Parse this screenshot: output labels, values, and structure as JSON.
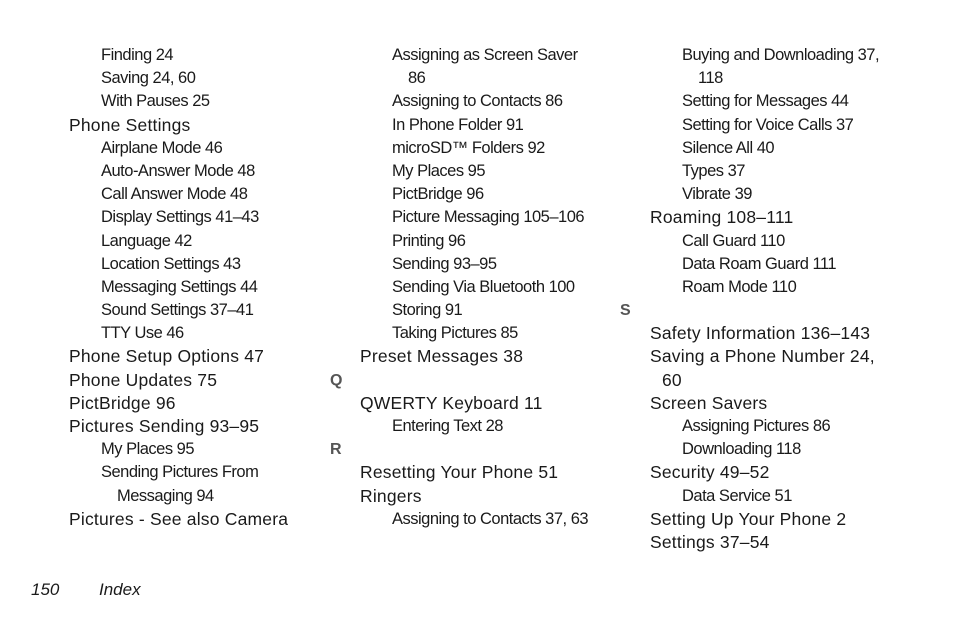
{
  "columns": [
    [
      {
        "level": "level-1",
        "text": "Finding 24"
      },
      {
        "level": "level-1",
        "text": "Saving 24, 60"
      },
      {
        "level": "level-1",
        "text": "With Pauses 25"
      },
      {
        "level": "level-0",
        "text": "Phone Settings"
      },
      {
        "level": "level-1",
        "text": "Airplane Mode 46"
      },
      {
        "level": "level-1",
        "text": "Auto-Answer Mode 48"
      },
      {
        "level": "level-1",
        "text": "Call Answer Mode 48"
      },
      {
        "level": "level-1",
        "text": "Display Settings 41–43"
      },
      {
        "level": "level-1",
        "text": "Language 42"
      },
      {
        "level": "level-1",
        "text": "Location Settings 43"
      },
      {
        "level": "level-1",
        "text": "Messaging Settings 44"
      },
      {
        "level": "level-1",
        "text": "Sound Settings 37–41"
      },
      {
        "level": "level-1",
        "text": "TTY Use 46"
      },
      {
        "level": "level-0",
        "text": "Phone Setup Options 47"
      },
      {
        "level": "level-0",
        "text": "Phone Updates 75"
      },
      {
        "level": "level-0",
        "text": "PictBridge 96"
      },
      {
        "level": "level-0",
        "text": "Pictures Sending 93–95"
      },
      {
        "level": "level-1",
        "text": "My Places 95"
      },
      {
        "level": "level-1",
        "text": "Sending Pictures From"
      },
      {
        "level": "level-1c",
        "text": "Messaging 94"
      },
      {
        "level": "level-0",
        "text": "Pictures - See also Camera"
      }
    ],
    [
      {
        "level": "level-1",
        "text": "Assigning as Screen Saver"
      },
      {
        "level": "level-1c",
        "text": "86"
      },
      {
        "level": "level-1",
        "text": "Assigning to Contacts 86"
      },
      {
        "level": "level-1",
        "text": "In Phone Folder 91"
      },
      {
        "level": "level-1",
        "text": "microSD™ Folders 92"
      },
      {
        "level": "level-1",
        "text": "My Places 95"
      },
      {
        "level": "level-1",
        "text": "PictBridge 96"
      },
      {
        "level": "level-1",
        "text": "Picture Messaging 105–106"
      },
      {
        "level": "level-1",
        "text": "Printing 96"
      },
      {
        "level": "level-1",
        "text": "Sending 93–95"
      },
      {
        "level": "level-1",
        "text": "Sending Via Bluetooth 100"
      },
      {
        "level": "level-1",
        "text": "Storing 91"
      },
      {
        "level": "level-1",
        "text": "Taking Pictures 85"
      },
      {
        "level": "level-0",
        "text": "Preset Messages 38"
      },
      {
        "level": "letter",
        "text": "Q"
      },
      {
        "level": "level-0",
        "text": "QWERTY Keyboard 11"
      },
      {
        "level": "level-1",
        "text": "Entering Text 28"
      },
      {
        "level": "letter",
        "text": "R"
      },
      {
        "level": "level-0",
        "text": "Resetting Your Phone 51"
      },
      {
        "level": "level-0",
        "text": "Ringers"
      },
      {
        "level": "level-1",
        "text": "Assigning to Contacts 37, 63"
      }
    ],
    [
      {
        "level": "level-1",
        "text": "Buying and Downloading 37,"
      },
      {
        "level": "level-1c",
        "text": "118"
      },
      {
        "level": "level-1",
        "text": "Setting for Messages 44"
      },
      {
        "level": "level-1",
        "text": "Setting for Voice Calls 37"
      },
      {
        "level": "level-1",
        "text": "Silence All 40"
      },
      {
        "level": "level-1",
        "text": "Types 37"
      },
      {
        "level": "level-1",
        "text": "Vibrate 39"
      },
      {
        "level": "level-0",
        "text": "Roaming 108–111"
      },
      {
        "level": "level-1",
        "text": "Call Guard 110"
      },
      {
        "level": "level-1",
        "text": "Data Roam Guard 111"
      },
      {
        "level": "level-1",
        "text": "Roam Mode 110"
      },
      {
        "level": "letter",
        "text": "S"
      },
      {
        "level": "level-0",
        "text": "Safety Information 136–143"
      },
      {
        "level": "level-0",
        "text": "Saving a Phone Number 24,"
      },
      {
        "level": "level-0c",
        "text": "60"
      },
      {
        "level": "level-0",
        "text": "Screen Savers"
      },
      {
        "level": "level-1",
        "text": "Assigning Pictures 86"
      },
      {
        "level": "level-1",
        "text": "Downloading 118"
      },
      {
        "level": "level-0",
        "text": "Security 49–52"
      },
      {
        "level": "level-1",
        "text": "Data Service 51"
      },
      {
        "level": "level-0",
        "text": "Setting Up Your Phone 2"
      },
      {
        "level": "level-0",
        "text": "Settings 37–54"
      }
    ]
  ],
  "footer": {
    "page_number": "150",
    "section": "Index"
  },
  "colors": {
    "text": "#1a1a1a",
    "letter_heading": "#555555",
    "background": "#ffffff"
  }
}
